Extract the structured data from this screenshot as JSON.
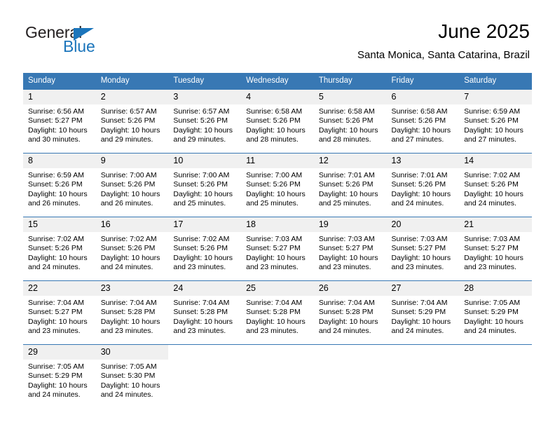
{
  "brand": {
    "name_part1": "General",
    "name_part2": "Blue",
    "logo_icon": "triangle-logo-icon",
    "accent_color": "#1b75bb"
  },
  "header": {
    "title": "June 2025",
    "location": "Santa Monica, Santa Catarina, Brazil"
  },
  "theme": {
    "header_bg": "#3878b4",
    "daynum_bg": "#f0f0f0",
    "row_border": "#3878b4"
  },
  "labels": {
    "sunrise_prefix": "Sunrise:",
    "sunset_prefix": "Sunset:",
    "daylight_prefix": "Daylight:"
  },
  "columns": [
    "Sunday",
    "Monday",
    "Tuesday",
    "Wednesday",
    "Thursday",
    "Friday",
    "Saturday"
  ],
  "weeks": [
    [
      {
        "day": "1",
        "sunrise": "Sunrise: 6:56 AM",
        "sunset": "Sunset: 5:27 PM",
        "daylight_line1": "Daylight: 10 hours",
        "daylight_line2": "and 30 minutes."
      },
      {
        "day": "2",
        "sunrise": "Sunrise: 6:57 AM",
        "sunset": "Sunset: 5:26 PM",
        "daylight_line1": "Daylight: 10 hours",
        "daylight_line2": "and 29 minutes."
      },
      {
        "day": "3",
        "sunrise": "Sunrise: 6:57 AM",
        "sunset": "Sunset: 5:26 PM",
        "daylight_line1": "Daylight: 10 hours",
        "daylight_line2": "and 29 minutes."
      },
      {
        "day": "4",
        "sunrise": "Sunrise: 6:58 AM",
        "sunset": "Sunset: 5:26 PM",
        "daylight_line1": "Daylight: 10 hours",
        "daylight_line2": "and 28 minutes."
      },
      {
        "day": "5",
        "sunrise": "Sunrise: 6:58 AM",
        "sunset": "Sunset: 5:26 PM",
        "daylight_line1": "Daylight: 10 hours",
        "daylight_line2": "and 28 minutes."
      },
      {
        "day": "6",
        "sunrise": "Sunrise: 6:58 AM",
        "sunset": "Sunset: 5:26 PM",
        "daylight_line1": "Daylight: 10 hours",
        "daylight_line2": "and 27 minutes."
      },
      {
        "day": "7",
        "sunrise": "Sunrise: 6:59 AM",
        "sunset": "Sunset: 5:26 PM",
        "daylight_line1": "Daylight: 10 hours",
        "daylight_line2": "and 27 minutes."
      }
    ],
    [
      {
        "day": "8",
        "sunrise": "Sunrise: 6:59 AM",
        "sunset": "Sunset: 5:26 PM",
        "daylight_line1": "Daylight: 10 hours",
        "daylight_line2": "and 26 minutes."
      },
      {
        "day": "9",
        "sunrise": "Sunrise: 7:00 AM",
        "sunset": "Sunset: 5:26 PM",
        "daylight_line1": "Daylight: 10 hours",
        "daylight_line2": "and 26 minutes."
      },
      {
        "day": "10",
        "sunrise": "Sunrise: 7:00 AM",
        "sunset": "Sunset: 5:26 PM",
        "daylight_line1": "Daylight: 10 hours",
        "daylight_line2": "and 25 minutes."
      },
      {
        "day": "11",
        "sunrise": "Sunrise: 7:00 AM",
        "sunset": "Sunset: 5:26 PM",
        "daylight_line1": "Daylight: 10 hours",
        "daylight_line2": "and 25 minutes."
      },
      {
        "day": "12",
        "sunrise": "Sunrise: 7:01 AM",
        "sunset": "Sunset: 5:26 PM",
        "daylight_line1": "Daylight: 10 hours",
        "daylight_line2": "and 25 minutes."
      },
      {
        "day": "13",
        "sunrise": "Sunrise: 7:01 AM",
        "sunset": "Sunset: 5:26 PM",
        "daylight_line1": "Daylight: 10 hours",
        "daylight_line2": "and 24 minutes."
      },
      {
        "day": "14",
        "sunrise": "Sunrise: 7:02 AM",
        "sunset": "Sunset: 5:26 PM",
        "daylight_line1": "Daylight: 10 hours",
        "daylight_line2": "and 24 minutes."
      }
    ],
    [
      {
        "day": "15",
        "sunrise": "Sunrise: 7:02 AM",
        "sunset": "Sunset: 5:26 PM",
        "daylight_line1": "Daylight: 10 hours",
        "daylight_line2": "and 24 minutes."
      },
      {
        "day": "16",
        "sunrise": "Sunrise: 7:02 AM",
        "sunset": "Sunset: 5:26 PM",
        "daylight_line1": "Daylight: 10 hours",
        "daylight_line2": "and 24 minutes."
      },
      {
        "day": "17",
        "sunrise": "Sunrise: 7:02 AM",
        "sunset": "Sunset: 5:26 PM",
        "daylight_line1": "Daylight: 10 hours",
        "daylight_line2": "and 23 minutes."
      },
      {
        "day": "18",
        "sunrise": "Sunrise: 7:03 AM",
        "sunset": "Sunset: 5:27 PM",
        "daylight_line1": "Daylight: 10 hours",
        "daylight_line2": "and 23 minutes."
      },
      {
        "day": "19",
        "sunrise": "Sunrise: 7:03 AM",
        "sunset": "Sunset: 5:27 PM",
        "daylight_line1": "Daylight: 10 hours",
        "daylight_line2": "and 23 minutes."
      },
      {
        "day": "20",
        "sunrise": "Sunrise: 7:03 AM",
        "sunset": "Sunset: 5:27 PM",
        "daylight_line1": "Daylight: 10 hours",
        "daylight_line2": "and 23 minutes."
      },
      {
        "day": "21",
        "sunrise": "Sunrise: 7:03 AM",
        "sunset": "Sunset: 5:27 PM",
        "daylight_line1": "Daylight: 10 hours",
        "daylight_line2": "and 23 minutes."
      }
    ],
    [
      {
        "day": "22",
        "sunrise": "Sunrise: 7:04 AM",
        "sunset": "Sunset: 5:27 PM",
        "daylight_line1": "Daylight: 10 hours",
        "daylight_line2": "and 23 minutes."
      },
      {
        "day": "23",
        "sunrise": "Sunrise: 7:04 AM",
        "sunset": "Sunset: 5:28 PM",
        "daylight_line1": "Daylight: 10 hours",
        "daylight_line2": "and 23 minutes."
      },
      {
        "day": "24",
        "sunrise": "Sunrise: 7:04 AM",
        "sunset": "Sunset: 5:28 PM",
        "daylight_line1": "Daylight: 10 hours",
        "daylight_line2": "and 23 minutes."
      },
      {
        "day": "25",
        "sunrise": "Sunrise: 7:04 AM",
        "sunset": "Sunset: 5:28 PM",
        "daylight_line1": "Daylight: 10 hours",
        "daylight_line2": "and 23 minutes."
      },
      {
        "day": "26",
        "sunrise": "Sunrise: 7:04 AM",
        "sunset": "Sunset: 5:28 PM",
        "daylight_line1": "Daylight: 10 hours",
        "daylight_line2": "and 24 minutes."
      },
      {
        "day": "27",
        "sunrise": "Sunrise: 7:04 AM",
        "sunset": "Sunset: 5:29 PM",
        "daylight_line1": "Daylight: 10 hours",
        "daylight_line2": "and 24 minutes."
      },
      {
        "day": "28",
        "sunrise": "Sunrise: 7:05 AM",
        "sunset": "Sunset: 5:29 PM",
        "daylight_line1": "Daylight: 10 hours",
        "daylight_line2": "and 24 minutes."
      }
    ],
    [
      {
        "day": "29",
        "sunrise": "Sunrise: 7:05 AM",
        "sunset": "Sunset: 5:29 PM",
        "daylight_line1": "Daylight: 10 hours",
        "daylight_line2": "and 24 minutes."
      },
      {
        "day": "30",
        "sunrise": "Sunrise: 7:05 AM",
        "sunset": "Sunset: 5:30 PM",
        "daylight_line1": "Daylight: 10 hours",
        "daylight_line2": "and 24 minutes."
      },
      {
        "day": "",
        "sunrise": "",
        "sunset": "",
        "daylight_line1": "",
        "daylight_line2": ""
      },
      {
        "day": "",
        "sunrise": "",
        "sunset": "",
        "daylight_line1": "",
        "daylight_line2": ""
      },
      {
        "day": "",
        "sunrise": "",
        "sunset": "",
        "daylight_line1": "",
        "daylight_line2": ""
      },
      {
        "day": "",
        "sunrise": "",
        "sunset": "",
        "daylight_line1": "",
        "daylight_line2": ""
      },
      {
        "day": "",
        "sunrise": "",
        "sunset": "",
        "daylight_line1": "",
        "daylight_line2": ""
      }
    ]
  ]
}
